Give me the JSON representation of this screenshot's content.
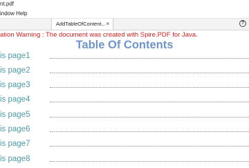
{
  "window": {
    "title": "nt.pdf"
  },
  "menu": {
    "items": [
      "indow",
      "Help"
    ]
  },
  "tabs": [
    {
      "label": "AddTableOfContent...",
      "close": "×"
    }
  ],
  "help_label": "?",
  "document": {
    "warning": "ation Warning : The document was created with Spire.PDF for Java.",
    "toc_title": "Table Of Contents",
    "entries": [
      "is page1",
      "is page2",
      "is page3",
      "is page4",
      "is page5",
      "is page6",
      "is page7",
      "is page8"
    ]
  },
  "colors": {
    "warning": "#d02020",
    "toc_title": "#6f94c9",
    "entry": "#4c9ba8"
  }
}
